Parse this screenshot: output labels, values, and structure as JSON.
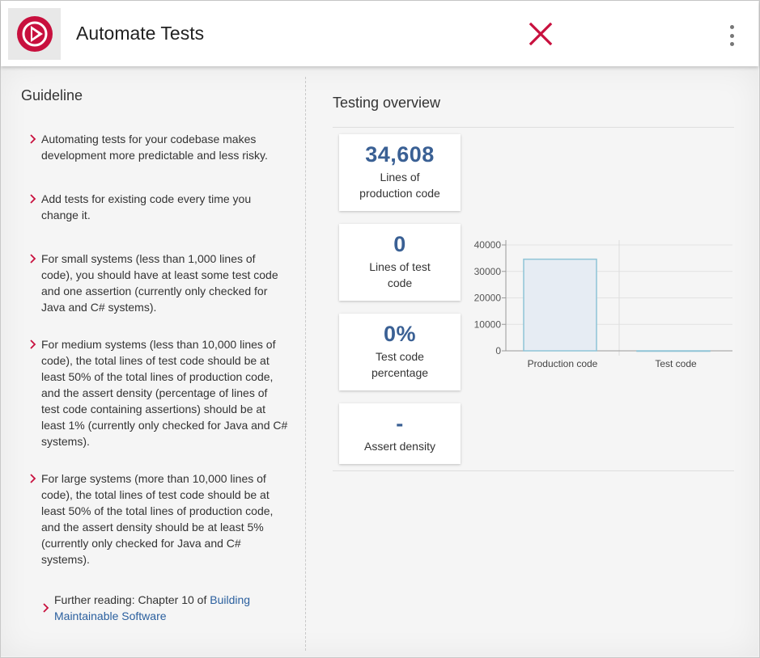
{
  "header": {
    "title": "Automate Tests",
    "logo_icon": "play-circle-icon",
    "close_icon": "close-icon",
    "menu_icon": "kebab-menu-icon",
    "accent_color": "#c8103e"
  },
  "guideline": {
    "title": "Guideline",
    "items": [
      "Automating tests for your codebase makes development more predictable and less risky.",
      "Add tests for existing code every time you change it.",
      "For small systems (less than 1,000 lines of code), you should have at least some test code and one assertion (currently only checked for Java and C# systems).",
      "For medium systems (less than 10,000 lines of code), the total lines of test code should be at least 50% of the total lines of production code, and the assert density (percentage of lines of test code containing assertions) should be at least 1% (currently only checked for Java and C# systems).",
      "For large systems (more than 10,000 lines of code), the total lines of test code should be at least 50% of the total lines of production code, and the assert density should be at least 5% (currently only checked for Java and C# systems)."
    ],
    "further_reading_prefix": "Further reading: Chapter 10 of ",
    "further_reading_link": "Building Maintainable Software"
  },
  "overview": {
    "title": "Testing overview",
    "cards": [
      {
        "value": "34,608",
        "label": "Lines of production code"
      },
      {
        "value": "0",
        "label": "Lines of test code"
      },
      {
        "value": "0%",
        "label": "Test code percentage"
      },
      {
        "value": "-",
        "label": "Assert density"
      }
    ]
  },
  "chart_data": {
    "type": "bar",
    "categories": [
      "Production code",
      "Test code"
    ],
    "values": [
      34608,
      0
    ],
    "ylim": [
      0,
      40000
    ],
    "yticks": [
      "0",
      "10000",
      "20000",
      "30000",
      "40000"
    ],
    "grid": true,
    "bar_fill": "#e6ecf3",
    "bar_stroke": "#8fc4d6"
  }
}
